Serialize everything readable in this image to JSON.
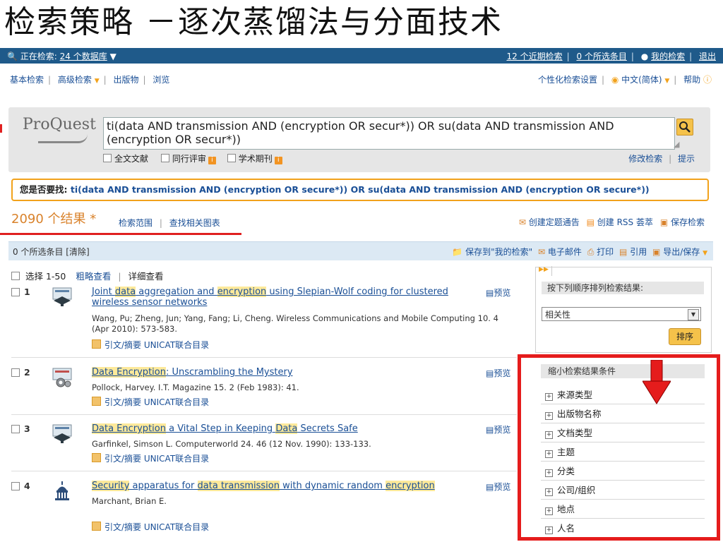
{
  "slide_title": "检索策略 －逐次蒸馏法与分面技术",
  "topbar": {
    "searching_label": "正在检索:",
    "db_link": "24 个数据库",
    "recent_searches": "12 个近期检索",
    "selected_items": "0 个所选条目",
    "my_searches": "我的检索",
    "logout": "退出"
  },
  "nav": {
    "basic": "基本检索",
    "advanced": "高级检索",
    "publications": "出版物",
    "browse": "浏览",
    "personalize": "个性化检索设置",
    "language": "中文(简体)",
    "help": "帮助"
  },
  "search": {
    "logo": "ProQuest",
    "query": "ti(data AND transmission AND (encryption OR secur*)) OR su(data AND transmission AND (encryption OR secur*))",
    "filter_fulltext": "全文文献",
    "filter_peer": "同行评审",
    "filter_scholarly": "学术期刊",
    "modify": "修改检索",
    "tips": "提示"
  },
  "suggest": {
    "label": "您是否要找:",
    "query": "ti(data AND transmission AND (encryption OR secure*)) OR su(data AND transmission AND (encryption OR secure*))"
  },
  "results": {
    "count": "2090 个结果 *",
    "scope": "检索范围",
    "related_charts": "查找相关图表",
    "alert": "创建定题通告",
    "rss": "创建 RSS 荟萃",
    "save_search": "保存检索"
  },
  "selbar": {
    "selected": "0 个所选条目 [清除]",
    "save_to": "保存到\"我的检索\"",
    "email": "电子邮件",
    "print": "打印",
    "cite": "引用",
    "export": "导出/保存"
  },
  "view": {
    "select": "选择 1-50",
    "brief": "粗略查看",
    "detailed": "详细查看"
  },
  "items": [
    {
      "num": "1",
      "title_parts": [
        "Joint ",
        "data",
        " aggregation and ",
        "encryption",
        " using Slepian-Wolf coding for clustered wireless sensor networks"
      ],
      "meta": "Wang, Pu; Zheng, Jun; Yang, Fang; Li, Cheng. Wireless Communications and Mobile Computing 10. 4  (Apr 2010): 573-583.",
      "cite": "引文/摘要  UNICAT联合目录",
      "preview": "预览"
    },
    {
      "num": "2",
      "title_parts": [
        "Data Encryption",
        ": Unscrambling the Mystery"
      ],
      "meta": "Pollock, Harvey. I.T. Magazine 15. 2  (Feb 1983): 41.",
      "cite": "引文/摘要  UNICAT联合目录",
      "preview": "预览"
    },
    {
      "num": "3",
      "title_parts": [
        "Data Encryption",
        " a Vital Step in Keeping ",
        "Data",
        " Secrets Safe"
      ],
      "meta": "Garfinkel, Simson L. Computerworld 24. 46  (12 Nov. 1990): 133-133.",
      "cite": "引文/摘要  UNICAT联合目录",
      "preview": "预览"
    },
    {
      "num": "4",
      "title_parts": [
        "Security",
        " apparatus for ",
        "data transmission",
        " with dynamic random ",
        "encryption"
      ],
      "meta": "Marchant, Brian E.",
      "cite": "引文/摘要  UNICAT联合目录",
      "preview": "预览"
    }
  ],
  "sort": {
    "heading": "按下列顺序排列检索结果:",
    "selected": "相关性",
    "button": "排序"
  },
  "narrow": {
    "heading": "缩小检索结果条件",
    "items": [
      "来源类型",
      "出版物名称",
      "文档类型",
      "主题",
      "分类",
      "公司/组织",
      "地点",
      "人名"
    ]
  },
  "colors": {
    "topbar": "#1f5a8a",
    "link": "#1a4f96",
    "highlight": "#fde99a",
    "accent_orange": "#f2a21b",
    "annotation_red": "#e51c1c"
  }
}
